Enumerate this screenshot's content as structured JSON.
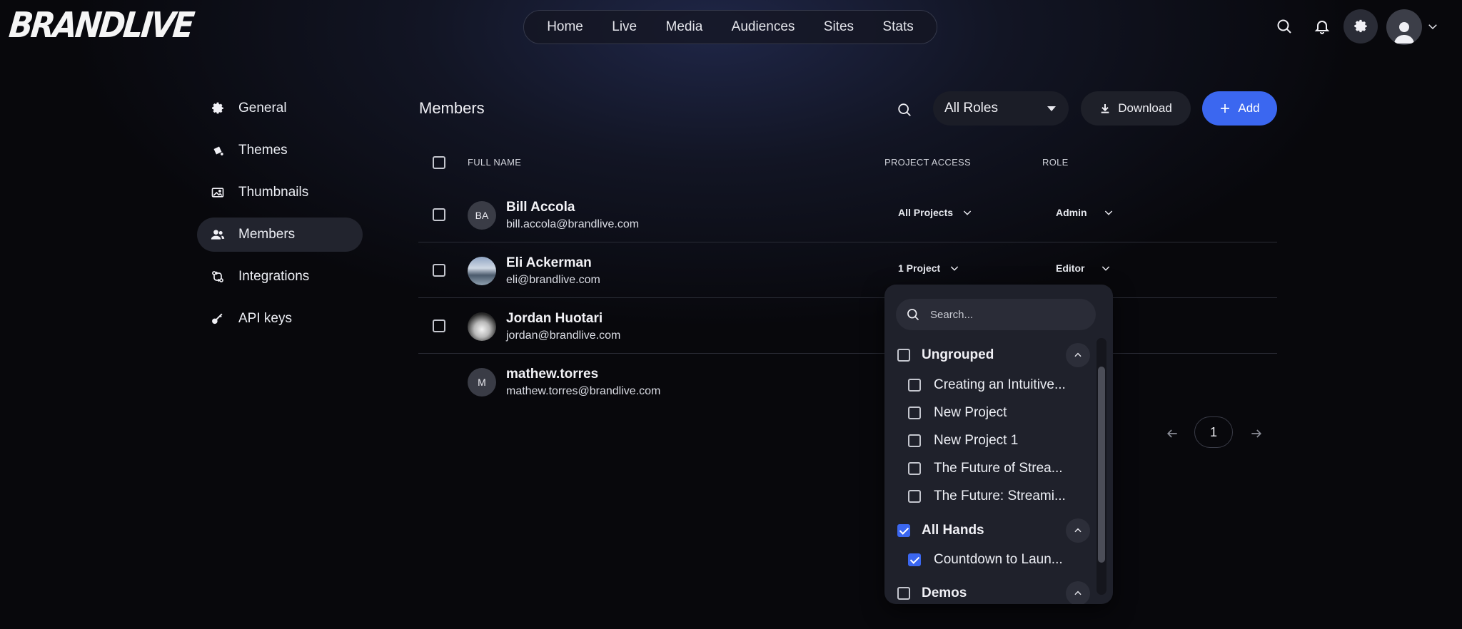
{
  "brand": {
    "logo_text": "BRANDLIVE"
  },
  "topnav": {
    "items": [
      "Home",
      "Live",
      "Media",
      "Audiences",
      "Sites",
      "Stats"
    ]
  },
  "header_icons": [
    "search-icon",
    "bell-icon",
    "gear-icon",
    "user-avatar-icon",
    "chevron-down-icon"
  ],
  "sidebar": {
    "items": [
      {
        "label": "General",
        "icon": "gear-icon"
      },
      {
        "label": "Themes",
        "icon": "paint-bucket-icon"
      },
      {
        "label": "Thumbnails",
        "icon": "image-icon"
      },
      {
        "label": "Members",
        "icon": "users-icon",
        "active": true
      },
      {
        "label": "Integrations",
        "icon": "integrations-icon"
      },
      {
        "label": "API keys",
        "icon": "key-icon"
      }
    ]
  },
  "members": {
    "title": "Members",
    "roles_filter": "All Roles",
    "download_label": "Download",
    "add_label": "Add",
    "columns": {
      "name": "FULL NAME",
      "access": "PROJECT ACCESS",
      "role": "ROLE"
    },
    "rows": [
      {
        "initials": "BA",
        "name": "Bill Accola",
        "email": "bill.accola@brandlive.com",
        "access": "All Projects",
        "role": "Admin"
      },
      {
        "initials": "",
        "name": "Eli Ackerman",
        "email": "eli@brandlive.com",
        "access": "1 Project",
        "role": "Editor"
      },
      {
        "initials": "",
        "name": "Jordan Huotari",
        "email": "jordan@brandlive.com",
        "access": "",
        "role": ""
      },
      {
        "initials": "M",
        "name": "mathew.torres",
        "email": "mathew.torres@brandlive.com",
        "access": "",
        "role": ""
      }
    ],
    "pagination": {
      "current": "1"
    }
  },
  "dropdown": {
    "search_placeholder": "Search...",
    "groups": [
      {
        "label": "Ungrouped",
        "checked": false,
        "items": [
          {
            "label": "Creating an Intuitive...",
            "checked": false
          },
          {
            "label": "New Project",
            "checked": false
          },
          {
            "label": "New Project 1",
            "checked": false
          },
          {
            "label": "The Future of Strea...",
            "checked": false
          },
          {
            "label": "The Future: Streami...",
            "checked": false
          }
        ]
      },
      {
        "label": "All Hands",
        "checked": true,
        "items": [
          {
            "label": "Countdown to Laun...",
            "checked": true
          }
        ]
      },
      {
        "label": "Demos",
        "checked": false,
        "items": []
      }
    ]
  },
  "colors": {
    "accent": "#3b67f0",
    "background": "#08080c",
    "panel": "#1f212b"
  }
}
